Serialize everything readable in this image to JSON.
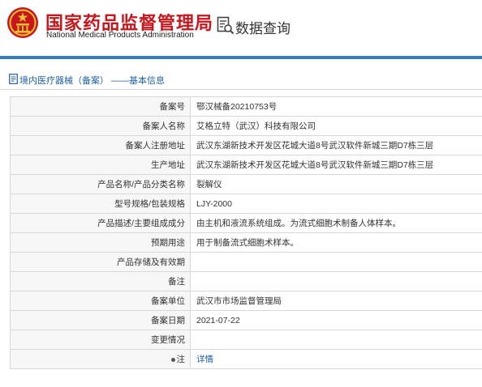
{
  "header": {
    "org_cn": "国家药品监督管理局",
    "org_en": "National Medical Products Administration",
    "query_title": "数据查询",
    "brand_color": "#c8161d",
    "accent_color": "#2f7fc3"
  },
  "breadcrumb": {
    "text": "境内医疗器械（备案） ——基本信息",
    "icon": "document-icon"
  },
  "record": {
    "rows": [
      {
        "label": "备案号",
        "value": "鄂汉械备20210753号"
      },
      {
        "label": "备案人名称",
        "value": "艾格立特（武汉）科技有限公司"
      },
      {
        "label": "备案人注册地址",
        "value": "武汉东湖新技术开发区花城大道8号武汉软件新城三期D7栋三层"
      },
      {
        "label": "生产地址",
        "value": "武汉东湖新技术开发区花城大道8号武汉软件新城三期D7栋三层"
      },
      {
        "label": "产品名称/产品分类名称",
        "value": "裂解仪"
      },
      {
        "label": "型号规格/包装规格",
        "value": "LJY-2000"
      },
      {
        "label": "产品描述/主要组成成分",
        "value": "由主机和液流系统组成。为流式细胞术制备人体样本。"
      },
      {
        "label": "预期用途",
        "value": "用于制备流式细胞术样本。"
      },
      {
        "label": "产品存储及有效期",
        "value": ""
      },
      {
        "label": "备注",
        "value": ""
      },
      {
        "label": "备案单位",
        "value": "武汉市市场监督管理局"
      },
      {
        "label": "备案日期",
        "value": "2021-07-22"
      },
      {
        "label": "变更情况",
        "value": ""
      }
    ],
    "note_label": "注",
    "note_link": "详情"
  }
}
